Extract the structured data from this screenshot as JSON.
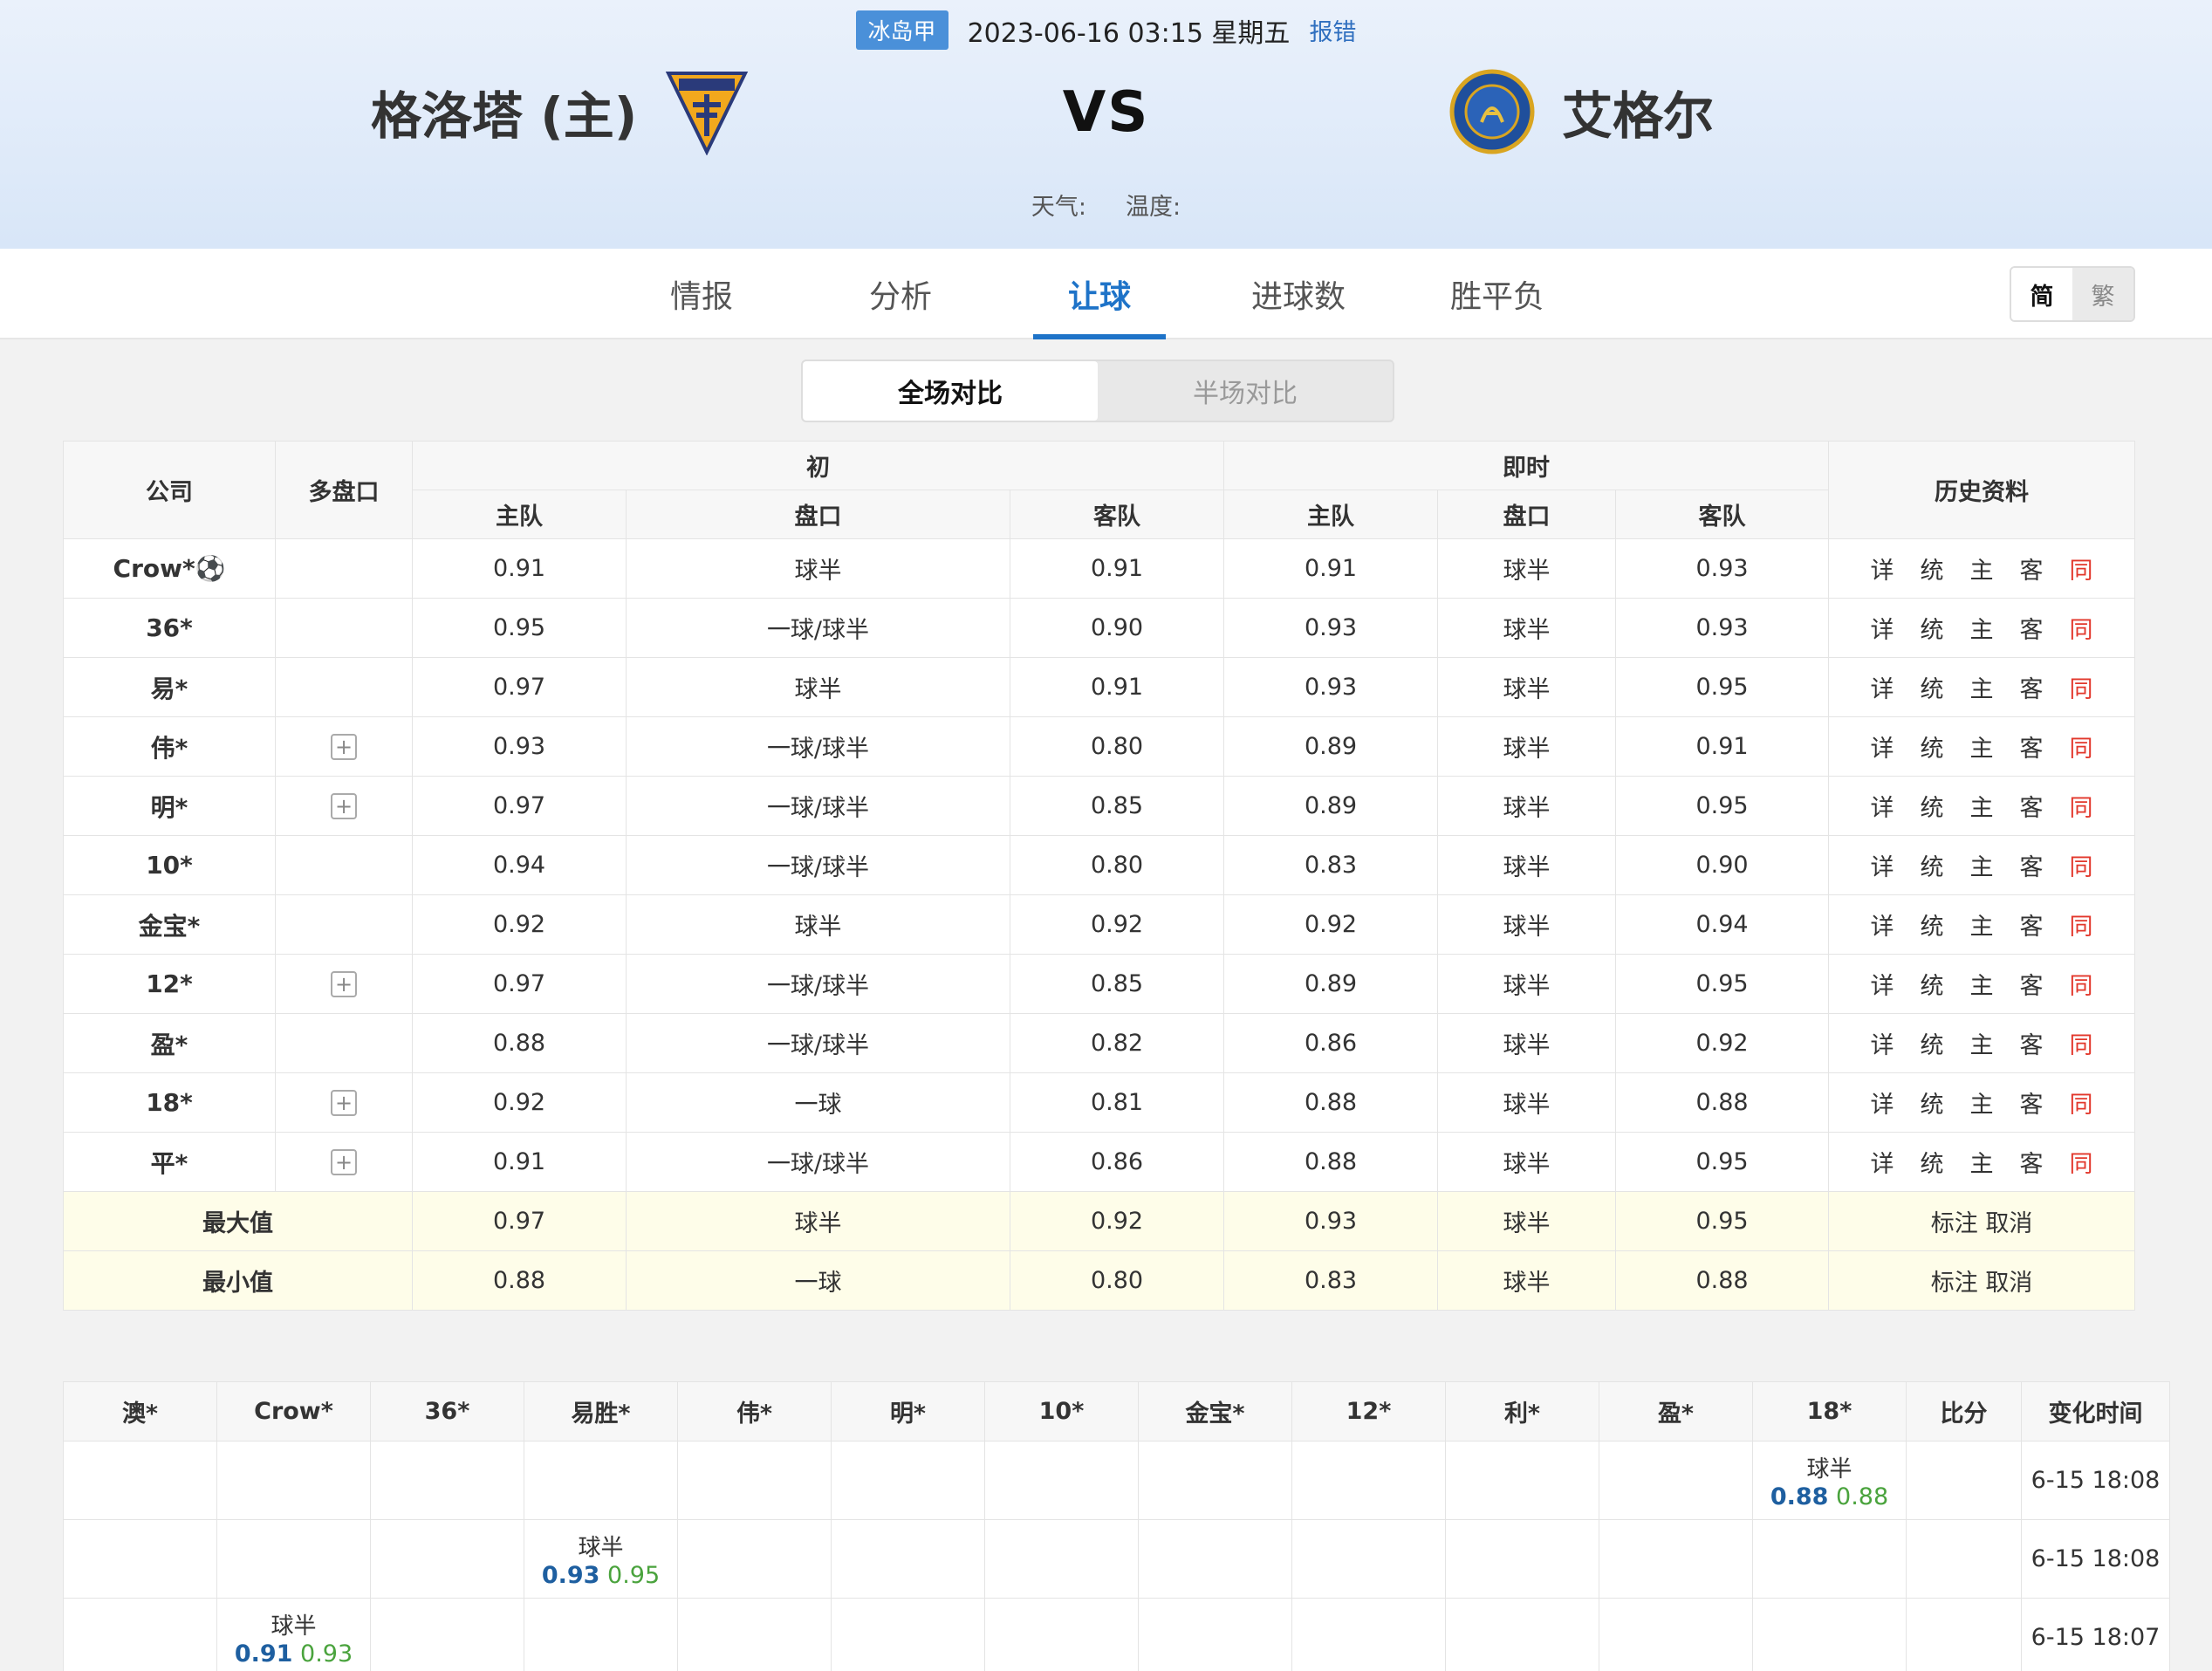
{
  "header": {
    "league": "冰岛甲",
    "datetime": "2023-06-16 03:15 星期五",
    "report": "报错",
    "home_team": "格洛塔 (主)",
    "away_team": "艾格尔",
    "vs": "VS",
    "weather_label": "天气:",
    "temperature_label": "温度:"
  },
  "tabs": [
    "情报",
    "分析",
    "让球",
    "进球数",
    "胜平负"
  ],
  "active_tab": "让球",
  "lang": {
    "simplified": "简",
    "traditional": "繁"
  },
  "segment": {
    "full": "全场对比",
    "half": "半场对比"
  },
  "odds_table": {
    "headers": {
      "company": "公司",
      "multi": "多盘口",
      "initial": "初",
      "live": "即时",
      "history": "历史资料",
      "home": "主队",
      "line": "盘口",
      "away": "客队"
    },
    "ops": [
      "详",
      "统",
      "主",
      "客",
      "同"
    ],
    "rows": [
      {
        "company": "Crow*⚽",
        "multi": false,
        "i_home": "0.91",
        "i_line": "球半",
        "i_away": "0.91",
        "l_home": "0.91",
        "l_line": "球半",
        "l_away": "0.93"
      },
      {
        "company": "36*",
        "multi": false,
        "i_home": "0.95",
        "i_line": "一球/球半",
        "i_away": "0.90",
        "l_home": "0.93",
        "l_line": "球半",
        "l_away": "0.93"
      },
      {
        "company": "易*",
        "multi": false,
        "i_home": "0.97",
        "i_line": "球半",
        "i_away": "0.91",
        "l_home": "0.93",
        "l_line": "球半",
        "l_away": "0.95"
      },
      {
        "company": "伟*",
        "multi": true,
        "i_home": "0.93",
        "i_line": "一球/球半",
        "i_away": "0.80",
        "l_home": "0.89",
        "l_line": "球半",
        "l_away": "0.91"
      },
      {
        "company": "明*",
        "multi": true,
        "i_home": "0.97",
        "i_line": "一球/球半",
        "i_away": "0.85",
        "l_home": "0.89",
        "l_line": "球半",
        "l_away": "0.95"
      },
      {
        "company": "10*",
        "multi": false,
        "i_home": "0.94",
        "i_line": "一球/球半",
        "i_away": "0.80",
        "l_home": "0.83",
        "l_line": "球半",
        "l_away": "0.90"
      },
      {
        "company": "金宝*",
        "multi": false,
        "i_home": "0.92",
        "i_line": "球半",
        "i_away": "0.92",
        "l_home": "0.92",
        "l_line": "球半",
        "l_away": "0.94"
      },
      {
        "company": "12*",
        "multi": true,
        "i_home": "0.97",
        "i_line": "一球/球半",
        "i_away": "0.85",
        "l_home": "0.89",
        "l_line": "球半",
        "l_away": "0.95"
      },
      {
        "company": "盈*",
        "multi": false,
        "i_home": "0.88",
        "i_line": "一球/球半",
        "i_away": "0.82",
        "l_home": "0.86",
        "l_line": "球半",
        "l_away": "0.92"
      },
      {
        "company": "18*",
        "multi": true,
        "i_home": "0.92",
        "i_line": "一球",
        "i_away": "0.81",
        "l_home": "0.88",
        "l_line": "球半",
        "l_away": "0.88"
      },
      {
        "company": "平*",
        "multi": true,
        "i_home": "0.91",
        "i_line": "一球/球半",
        "i_away": "0.86",
        "l_home": "0.88",
        "l_line": "球半",
        "l_away": "0.95"
      }
    ],
    "summary": [
      {
        "label": "最大值",
        "i_home": "0.97",
        "i_line": "球半",
        "i_away": "0.92",
        "l_home": "0.93",
        "l_line": "球半",
        "l_away": "0.95",
        "action": "标注 取消"
      },
      {
        "label": "最小值",
        "i_home": "0.88",
        "i_line": "一球",
        "i_away": "0.80",
        "l_home": "0.83",
        "l_line": "球半",
        "l_away": "0.88",
        "action": "标注 取消"
      }
    ]
  },
  "change_table": {
    "headers": [
      "澳*",
      "Crow*",
      "36*",
      "易胜*",
      "伟*",
      "明*",
      "10*",
      "金宝*",
      "12*",
      "利*",
      "盈*",
      "18*",
      "比分",
      "变化时间"
    ],
    "rows": [
      {
        "col": 11,
        "line": "球半",
        "home": "0.88",
        "away": "0.88",
        "time": "6-15 18:08"
      },
      {
        "col": 3,
        "line": "球半",
        "home": "0.93",
        "away": "0.95",
        "time": "6-15 18:08"
      },
      {
        "col": 1,
        "line": "球半",
        "home": "0.91",
        "away": "0.93",
        "time": "6-15 18:07"
      }
    ]
  }
}
